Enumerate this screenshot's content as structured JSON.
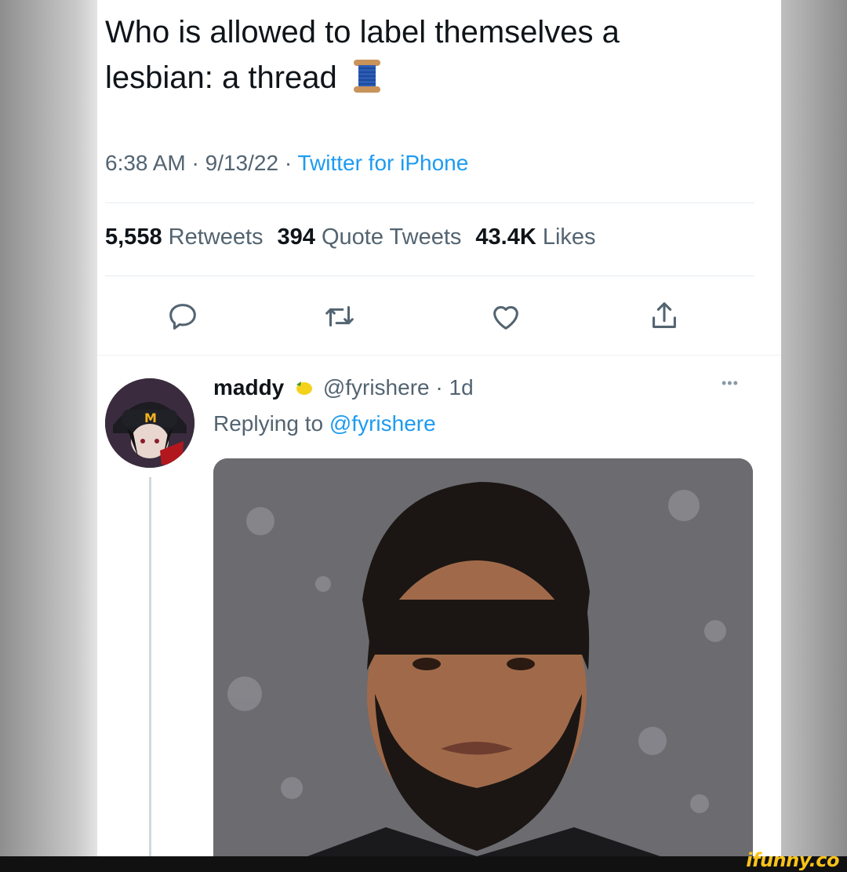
{
  "tweet": {
    "text_line1": "Who is allowed to label themselves a",
    "text_line2": "lesbian: a thread",
    "emoji": "spool-of-thread",
    "time": "6:38 AM",
    "date": "9/13/22",
    "source": "Twitter for iPhone",
    "sep": " · "
  },
  "stats": {
    "retweets_count": "5,558",
    "retweets_label": "Retweets",
    "quotes_count": "394",
    "quotes_label": "Quote Tweets",
    "likes_count": "43.4K",
    "likes_label": "Likes"
  },
  "actions": [
    "reply-icon",
    "retweet-icon",
    "like-icon",
    "share-icon"
  ],
  "reply": {
    "name": "maddy",
    "handle": "@fyrishere",
    "age": "1d",
    "replying_prefix": "Replying to",
    "replying_handle": "@fyrishere",
    "more": "•••"
  },
  "watermark": "ifunny.co",
  "colors": {
    "link": "#1d9bf0",
    "muted": "#536471",
    "text": "#0f1419"
  }
}
